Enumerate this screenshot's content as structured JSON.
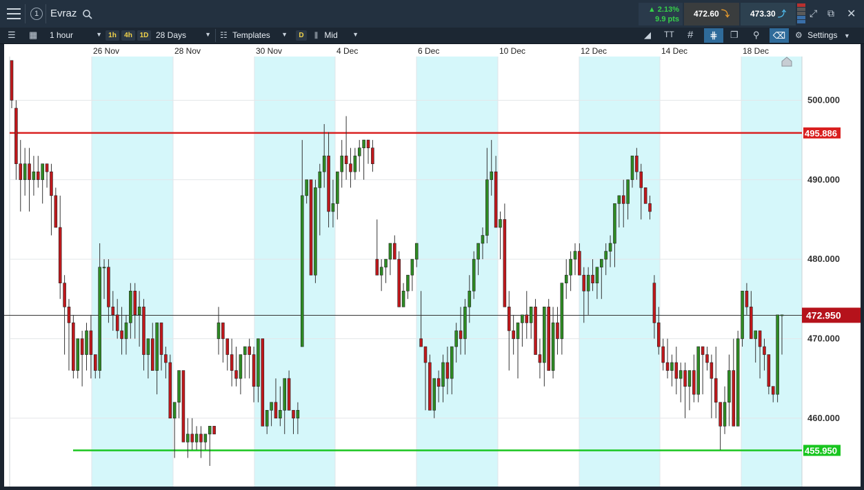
{
  "header": {
    "instrument": "Evraz",
    "alert_count": "1",
    "change_pct": "2.13%",
    "change_pts": "9.9 pts",
    "sell_price": "472.60",
    "buy_price": "473.30"
  },
  "toolbar": {
    "interval": "1 hour",
    "quick_intervals": [
      "1h",
      "4h",
      "1D"
    ],
    "range": "28 Days",
    "templates_label": "Templates",
    "d_label": "D",
    "price_type": "Mid",
    "settings_label": "Settings"
  },
  "colors": {
    "up": "#2e8b23",
    "down": "#c0181c",
    "resistance": "#d91f1f",
    "support": "#18c51f",
    "shade": "#d5f7fa"
  },
  "chart_data": {
    "type": "candlestick",
    "x_tick_labels": [
      "26 Nov",
      "28 Nov",
      "30 Nov",
      "4 Dec",
      "6 Dec",
      "10 Dec",
      "12 Dec",
      "14 Dec",
      "18 Dec"
    ],
    "y_tick_labels": [
      "500.000",
      "490.000",
      "480.000",
      "470.000",
      "460.000"
    ],
    "ylim": [
      451.4,
      505.5
    ],
    "current_price": "472.950",
    "resistance_label": "495.886",
    "support_label": "455.950",
    "levels": {
      "current": 472.95,
      "resistance": 495.886,
      "support": 455.95
    },
    "candles": [
      [
        505,
        505,
        499,
        500
      ],
      [
        499,
        500,
        490,
        492
      ],
      [
        492,
        495,
        486,
        490
      ],
      [
        490,
        494,
        488,
        492
      ],
      [
        492,
        494,
        486,
        490
      ],
      [
        490,
        493,
        488,
        491
      ],
      [
        491,
        493,
        489,
        490
      ],
      [
        490,
        492,
        487,
        492
      ],
      [
        492,
        492,
        489,
        491
      ],
      [
        491,
        492,
        483,
        488
      ],
      [
        488,
        489,
        484,
        484
      ],
      [
        484,
        488,
        475,
        477
      ],
      [
        477,
        478,
        468,
        474
      ],
      [
        474,
        475,
        466,
        472
      ],
      [
        472,
        473,
        465,
        466
      ],
      [
        466,
        470,
        465,
        470
      ],
      [
        470,
        471,
        464,
        468
      ],
      [
        468,
        472,
        466,
        471
      ],
      [
        471,
        473,
        465,
        468
      ],
      [
        468,
        468,
        465,
        466
      ],
      [
        466,
        482,
        465,
        479
      ],
      [
        479,
        480,
        475,
        479
      ],
      [
        479,
        480,
        472,
        474
      ],
      [
        474,
        476,
        471,
        473
      ],
      [
        473,
        475,
        470,
        471
      ],
      [
        471,
        474,
        468,
        470
      ],
      [
        470,
        473,
        468,
        472
      ],
      [
        472,
        477,
        470,
        476
      ],
      [
        476,
        477,
        470,
        473
      ],
      [
        473,
        476,
        469,
        474
      ],
      [
        474,
        475,
        466,
        468
      ],
      [
        468,
        470,
        465,
        470
      ],
      [
        470,
        472,
        466,
        466
      ],
      [
        466,
        468,
        463,
        472
      ],
      [
        472,
        472,
        466,
        468
      ],
      [
        468,
        469,
        465,
        467
      ],
      [
        467,
        468,
        462,
        460
      ],
      [
        460,
        462,
        455,
        462
      ],
      [
        462,
        466,
        460,
        466
      ],
      [
        466,
        466,
        457,
        457
      ],
      [
        457,
        460,
        455,
        458
      ],
      [
        458,
        460,
        456,
        457
      ],
      [
        457,
        459,
        456,
        458
      ],
      [
        458,
        459,
        455,
        457
      ],
      [
        457,
        458,
        456,
        458
      ],
      [
        458,
        458,
        454,
        459
      ],
      [
        459,
        459,
        458,
        458
      ],
      [
        470,
        474,
        468,
        472
      ],
      [
        472,
        472,
        467,
        470
      ],
      [
        470,
        470,
        466,
        468
      ],
      [
        468,
        470,
        464,
        466
      ],
      [
        466,
        469,
        464,
        465
      ],
      [
        465,
        467,
        463,
        468
      ],
      [
        468,
        469,
        465,
        469
      ],
      [
        469,
        470,
        465,
        468
      ],
      [
        468,
        469,
        462,
        464
      ],
      [
        464,
        466,
        462,
        470
      ],
      [
        470,
        470,
        460,
        459
      ],
      [
        459,
        461,
        458,
        461
      ],
      [
        461,
        461,
        459,
        462
      ],
      [
        462,
        465,
        460,
        460
      ],
      [
        460,
        464,
        459,
        461
      ],
      [
        461,
        462,
        458,
        465
      ],
      [
        465,
        466,
        462,
        461
      ],
      [
        461,
        461,
        458,
        460
      ],
      [
        460,
        462,
        458,
        461
      ],
      [
        469,
        495,
        469,
        488
      ],
      [
        488,
        490,
        487,
        490
      ],
      [
        490,
        490,
        479,
        478
      ],
      [
        478,
        490,
        477,
        489
      ],
      [
        489,
        492,
        483,
        491
      ],
      [
        491,
        497,
        489,
        493
      ],
      [
        493,
        496,
        484,
        486
      ],
      [
        486,
        490,
        484,
        487
      ],
      [
        487,
        488,
        485,
        491
      ],
      [
        491,
        495,
        489,
        493
      ],
      [
        493,
        498,
        490,
        492
      ],
      [
        492,
        494,
        489,
        491
      ],
      [
        491,
        494,
        490,
        493
      ],
      [
        493,
        495,
        491,
        494
      ],
      [
        494,
        495,
        490,
        495
      ],
      [
        495,
        495,
        492,
        494
      ],
      [
        494,
        495,
        491,
        492
      ],
      [
        480,
        485,
        480,
        478
      ],
      [
        478,
        480,
        476,
        479
      ],
      [
        479,
        480,
        477,
        480
      ],
      [
        480,
        482,
        478,
        482
      ],
      [
        482,
        483,
        480,
        480
      ],
      [
        480,
        481,
        474,
        474
      ],
      [
        474,
        477,
        474,
        476
      ],
      [
        476,
        478,
        475,
        478
      ],
      [
        478,
        479,
        476,
        480
      ],
      [
        480,
        482,
        479,
        482
      ],
      [
        470,
        476,
        470,
        469
      ],
      [
        469,
        469,
        461,
        467
      ],
      [
        467,
        468,
        462,
        461
      ],
      [
        461,
        463,
        460,
        465
      ],
      [
        465,
        466,
        462,
        464
      ],
      [
        464,
        468,
        462,
        467
      ],
      [
        467,
        469,
        463,
        465
      ],
      [
        465,
        468,
        463,
        469
      ],
      [
        469,
        472,
        467,
        471
      ],
      [
        471,
        474,
        468,
        470
      ],
      [
        470,
        475,
        468,
        474
      ],
      [
        474,
        478,
        472,
        476
      ],
      [
        476,
        481,
        475,
        480
      ],
      [
        480,
        482,
        478,
        482
      ],
      [
        482,
        484,
        480,
        483
      ],
      [
        483,
        494,
        482,
        490
      ],
      [
        490,
        495,
        488,
        491
      ],
      [
        491,
        493,
        484,
        484
      ],
      [
        484,
        486,
        480,
        485
      ],
      [
        485,
        487,
        478,
        474
      ],
      [
        474,
        476,
        466,
        471
      ],
      [
        471,
        473,
        468,
        470
      ],
      [
        470,
        472,
        465,
        472
      ],
      [
        472,
        473,
        469,
        473
      ],
      [
        473,
        476,
        470,
        472
      ],
      [
        472,
        474,
        470,
        474
      ],
      [
        474,
        475,
        468,
        468
      ],
      [
        468,
        470,
        465,
        467
      ],
      [
        467,
        471,
        464,
        474
      ],
      [
        474,
        475,
        471,
        466
      ],
      [
        466,
        474,
        465,
        472
      ],
      [
        472,
        474,
        468,
        470
      ],
      [
        470,
        476,
        468,
        477
      ],
      [
        477,
        480,
        475,
        478
      ],
      [
        478,
        481,
        476,
        480
      ],
      [
        480,
        482,
        478,
        481
      ],
      [
        481,
        482,
        479,
        478
      ],
      [
        478,
        479,
        472,
        476
      ],
      [
        476,
        479,
        473,
        478
      ],
      [
        478,
        480,
        476,
        477
      ],
      [
        477,
        478,
        475,
        479
      ],
      [
        479,
        480,
        475,
        480
      ],
      [
        480,
        482,
        478,
        481
      ],
      [
        481,
        483,
        479,
        482
      ],
      [
        482,
        484,
        479,
        487
      ],
      [
        487,
        488,
        484,
        488
      ],
      [
        488,
        490,
        484,
        487
      ],
      [
        487,
        490,
        485,
        490
      ],
      [
        490,
        492,
        489,
        493
      ],
      [
        493,
        494,
        490,
        491
      ],
      [
        491,
        492,
        485,
        489
      ],
      [
        489,
        488,
        488,
        487
      ],
      [
        487,
        488,
        485,
        486
      ],
      [
        477,
        478,
        470,
        472
      ],
      [
        472,
        474,
        468,
        469
      ],
      [
        469,
        470,
        466,
        467
      ],
      [
        467,
        470,
        465,
        466
      ],
      [
        466,
        468,
        464,
        467
      ],
      [
        467,
        469,
        463,
        465
      ],
      [
        465,
        467,
        462,
        466
      ],
      [
        466,
        467,
        460,
        464
      ],
      [
        464,
        466,
        461,
        466
      ],
      [
        466,
        468,
        462,
        463
      ],
      [
        463,
        468,
        462,
        469
      ],
      [
        469,
        469,
        463,
        468
      ],
      [
        468,
        469,
        466,
        467
      ],
      [
        467,
        468,
        460,
        465
      ],
      [
        465,
        469,
        460,
        462
      ],
      [
        462,
        462,
        456,
        459
      ],
      [
        459,
        464,
        458,
        462
      ],
      [
        462,
        468,
        459,
        466
      ],
      [
        466,
        470,
        459,
        459
      ],
      [
        459,
        471,
        459,
        470
      ],
      [
        470,
        476,
        469,
        476
      ],
      [
        476,
        477,
        473,
        474
      ],
      [
        474,
        476,
        470,
        470
      ],
      [
        470,
        471,
        467,
        471
      ],
      [
        471,
        470,
        465,
        469
      ],
      [
        469,
        470,
        466,
        468
      ],
      [
        468,
        466,
        463,
        464
      ],
      [
        464,
        464,
        462,
        463
      ],
      [
        463,
        469,
        462,
        473
      ],
      [
        473,
        473,
        468,
        473
      ]
    ]
  }
}
